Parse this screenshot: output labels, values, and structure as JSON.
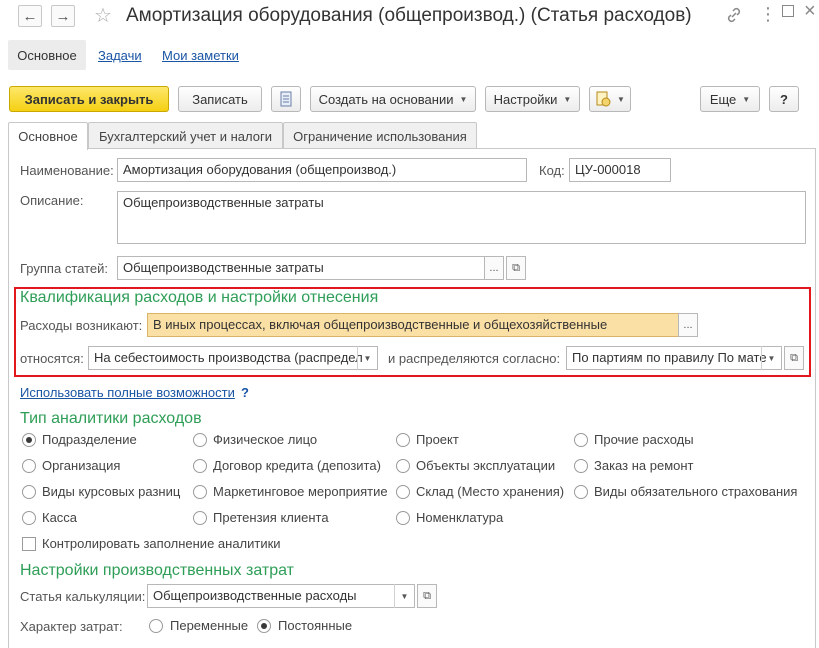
{
  "window": {
    "title": "Амортизация оборудования (общепроизвод.) (Статья расходов)",
    "back_icon": "←",
    "forward_icon": "→",
    "star_icon": "☆",
    "link_icon": "🔗",
    "more_icon": "⋮",
    "maximize_icon": "□",
    "close_icon": "×"
  },
  "sections": {
    "main": "Основное",
    "tasks": "Задачи",
    "notes": "Мои заметки"
  },
  "toolbar": {
    "save_close": "Записать и закрыть",
    "save": "Записать",
    "create_based": "Создать на основании",
    "settings": "Настройки",
    "more": "Еще",
    "help": "?"
  },
  "tabs": [
    "Основное",
    "Бухгалтерский учет и налоги",
    "Ограничение использования"
  ],
  "form": {
    "name_label": "Наименование:",
    "name_value": "Амортизация оборудования (общепроизвод.)",
    "code_label": "Код:",
    "code_value": "ЦУ-000018",
    "desc_label": "Описание:",
    "desc_value": "Общепроизводственные затраты",
    "group_label": "Группа статей:",
    "group_value": "Общепроизводственные затраты",
    "ellipsis": "...",
    "open_icon": "⧉"
  },
  "qualification": {
    "heading": "Квалификация расходов и настройки отнесения",
    "arise_label": "Расходы возникают:",
    "arise_value": "В иных процессах, включая общепроизводственные и общехозяйственные",
    "relate_label": "относятся:",
    "relate_value": "На себестоимость производства (распредел",
    "distrib_label": "и распределяются согласно:",
    "distrib_value": "По партиям по правилу По мате"
  },
  "full_features": {
    "link": "Использовать полные возможности",
    "help": "?"
  },
  "analytics": {
    "heading": "Тип аналитики расходов",
    "options": [
      {
        "label": "Подразделение",
        "selected": true
      },
      {
        "label": "Физическое лицо",
        "selected": false
      },
      {
        "label": "Проект",
        "selected": false
      },
      {
        "label": "Прочие расходы",
        "selected": false
      },
      {
        "label": "Организация",
        "selected": false
      },
      {
        "label": "Договор кредита (депозита)",
        "selected": false
      },
      {
        "label": "Объекты эксплуатации",
        "selected": false
      },
      {
        "label": "Заказ на ремонт",
        "selected": false
      },
      {
        "label": "Виды курсовых разниц",
        "selected": false
      },
      {
        "label": "Маркетинговое мероприятие",
        "selected": false
      },
      {
        "label": "Склад (Место хранения)",
        "selected": false
      },
      {
        "label": "Виды обязательного страхования",
        "selected": false
      },
      {
        "label": "Касса",
        "selected": false
      },
      {
        "label": "Претензия клиента",
        "selected": false
      },
      {
        "label": "Номенклатура",
        "selected": false
      }
    ],
    "control_fill": "Контролировать заполнение аналитики"
  },
  "production": {
    "heading": "Настройки производственных затрат",
    "calc_label": "Статья калькуляции:",
    "calc_value": "Общепроизводственные расходы",
    "nature_label": "Характер затрат:",
    "variable": "Переменные",
    "constant": "Постоянные",
    "selected": "Постоянные"
  },
  "colors": {
    "accent_green": "#2e9e57",
    "primary_yellow": "#f5d013",
    "highlight_field": "#fbe0a6",
    "red_frame": "#e3171c",
    "link_blue": "#1a55a4"
  }
}
